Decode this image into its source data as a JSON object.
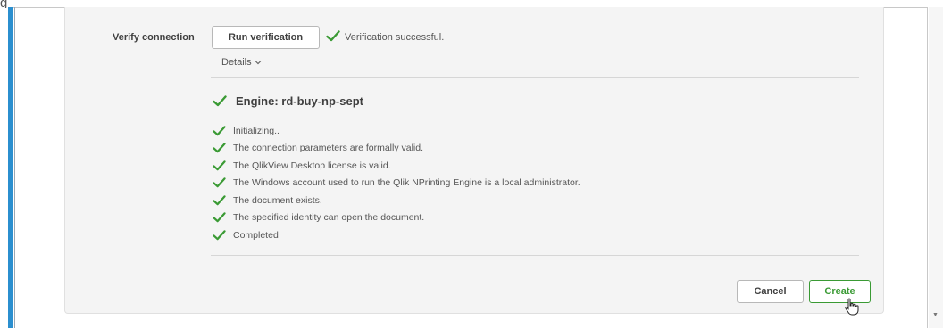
{
  "page_fragment_text": "g",
  "verify": {
    "label": "Verify connection",
    "run_button": "Run verification",
    "status_text": "Verification successful.",
    "details_label": "Details",
    "details_icon": "chevron-down-icon"
  },
  "engine": {
    "title": "Engine: rd-buy-np-sept"
  },
  "log": [
    "Initializing..",
    "The connection parameters are formally valid.",
    "The QlikView Desktop license is valid.",
    "The Windows account used to run the Qlik NPrinting Engine is a local administrator.",
    "The document exists.",
    "The specified identity can open the document.",
    "Completed"
  ],
  "footer": {
    "cancel_label": "Cancel",
    "create_label": "Create"
  },
  "colors": {
    "success_green": "#3a9a34",
    "accent_blue": "#2b8fcf",
    "panel_bg": "#f4f4f4"
  }
}
